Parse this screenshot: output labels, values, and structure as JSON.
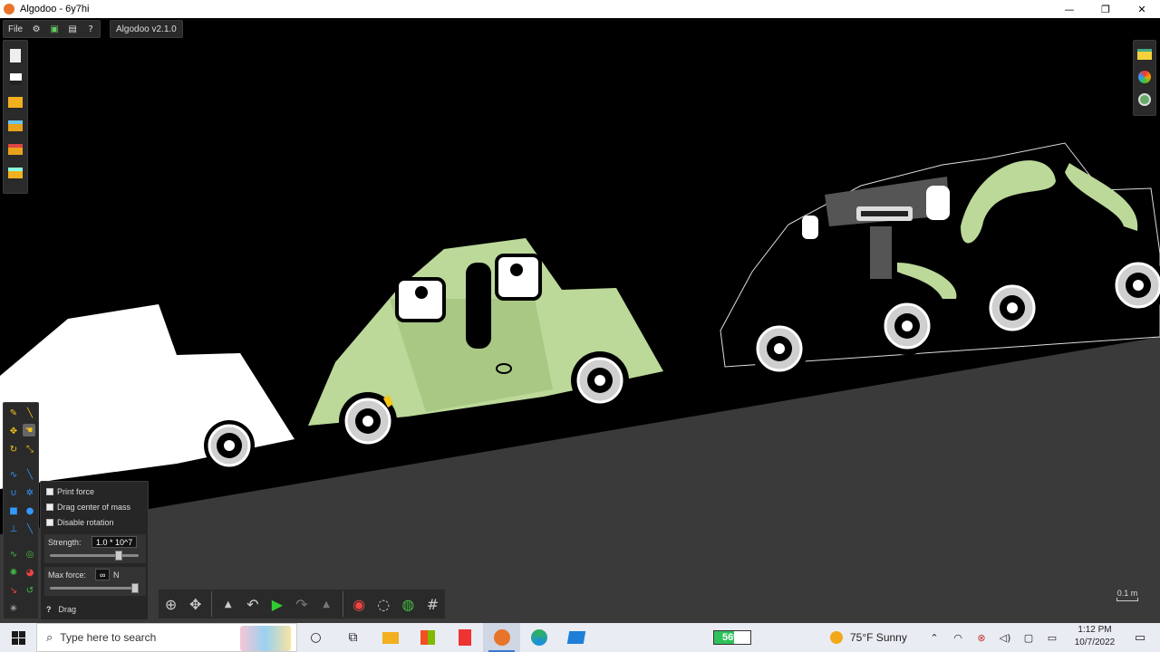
{
  "window": {
    "title": "Algodoo - 6y7hi",
    "minimize": "—",
    "restore": "❐",
    "close": "✕"
  },
  "menu": {
    "file": "File",
    "version": "Algodoo v2.1.0"
  },
  "file_toolbar": [
    "new-scene-icon",
    "clear-icon",
    "open-folder-icon",
    "phunlet-icon",
    "lessons-icon",
    "save-icon"
  ],
  "right_toolbar": [
    "layers-icon",
    "palette-icon",
    "zoom-to-fit-icon"
  ],
  "drag_options": {
    "print_force": "Print force",
    "drag_center_of_mass": "Drag center of mass",
    "disable_rotation": "Disable rotation",
    "strength_label": "Strength:",
    "strength_value": "1.0 * 10^7",
    "strength_level": 0.8,
    "max_force_label": "Max force:",
    "max_force_value": "∞",
    "max_force_unit": "N",
    "max_force_level": 1.0,
    "help": "?",
    "tool_name": "Drag"
  },
  "scale": {
    "label": "0.1 m"
  },
  "taskbar": {
    "search_placeholder": "Type here to search",
    "battery": "56%",
    "battery_level": 0.56,
    "weather": "75°F  Sunny",
    "time": "1:12 PM",
    "date": "10/7/2022"
  },
  "colors": {
    "accent_green": "#bcd99a",
    "ground": "#3a3a3a",
    "background": "#000000"
  }
}
